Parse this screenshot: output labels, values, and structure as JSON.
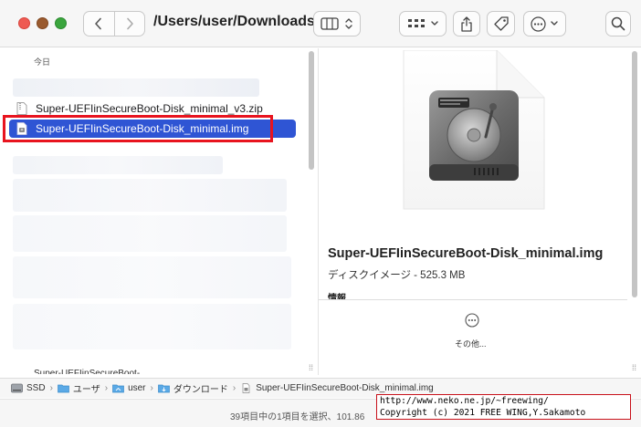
{
  "toolbar": {
    "title": "/Users/user/Downloads",
    "icons": [
      "chevron-left-icon",
      "chevron-right-icon",
      "column-view-icon",
      "group-grid-icon",
      "share-icon",
      "tag-icon",
      "more-icon",
      "search-icon"
    ]
  },
  "sidebar_list": {
    "section_label": "今日",
    "files": [
      {
        "name": "Super-UEFIinSecureBoot-Disk_minimal_v3.zip",
        "selected": false
      },
      {
        "name": "Super-UEFIinSecureBoot-Disk_minimal.img",
        "selected": true
      }
    ],
    "partial_item": "Super-UEFIinSecureBoot-..."
  },
  "preview": {
    "file_name": "Super-UEFIinSecureBoot-Disk_minimal.img",
    "kind_size": "ディスクイメージ - 525.3 MB",
    "info_label": "情報",
    "more_label": "その他..."
  },
  "pathbar": {
    "crumbs": [
      "SSD",
      "ユーザ",
      "user",
      "ダウンロード",
      "Super-UEFIinSecureBoot-Disk_minimal.img"
    ]
  },
  "statusbar": {
    "text": "39項目中の1項目を選択、101.86"
  },
  "watermark": {
    "line1": "http://www.neko.ne.jp/~freewing/",
    "line2": "Copyright (c) 2021 FREE WING,Y.Sakamoto"
  },
  "colors": {
    "selection": "#2f55d4",
    "highlight": "#e8141f",
    "close": "#ee5a52",
    "minimize": "#9a5a2e",
    "zoom": "#3aa53d"
  }
}
